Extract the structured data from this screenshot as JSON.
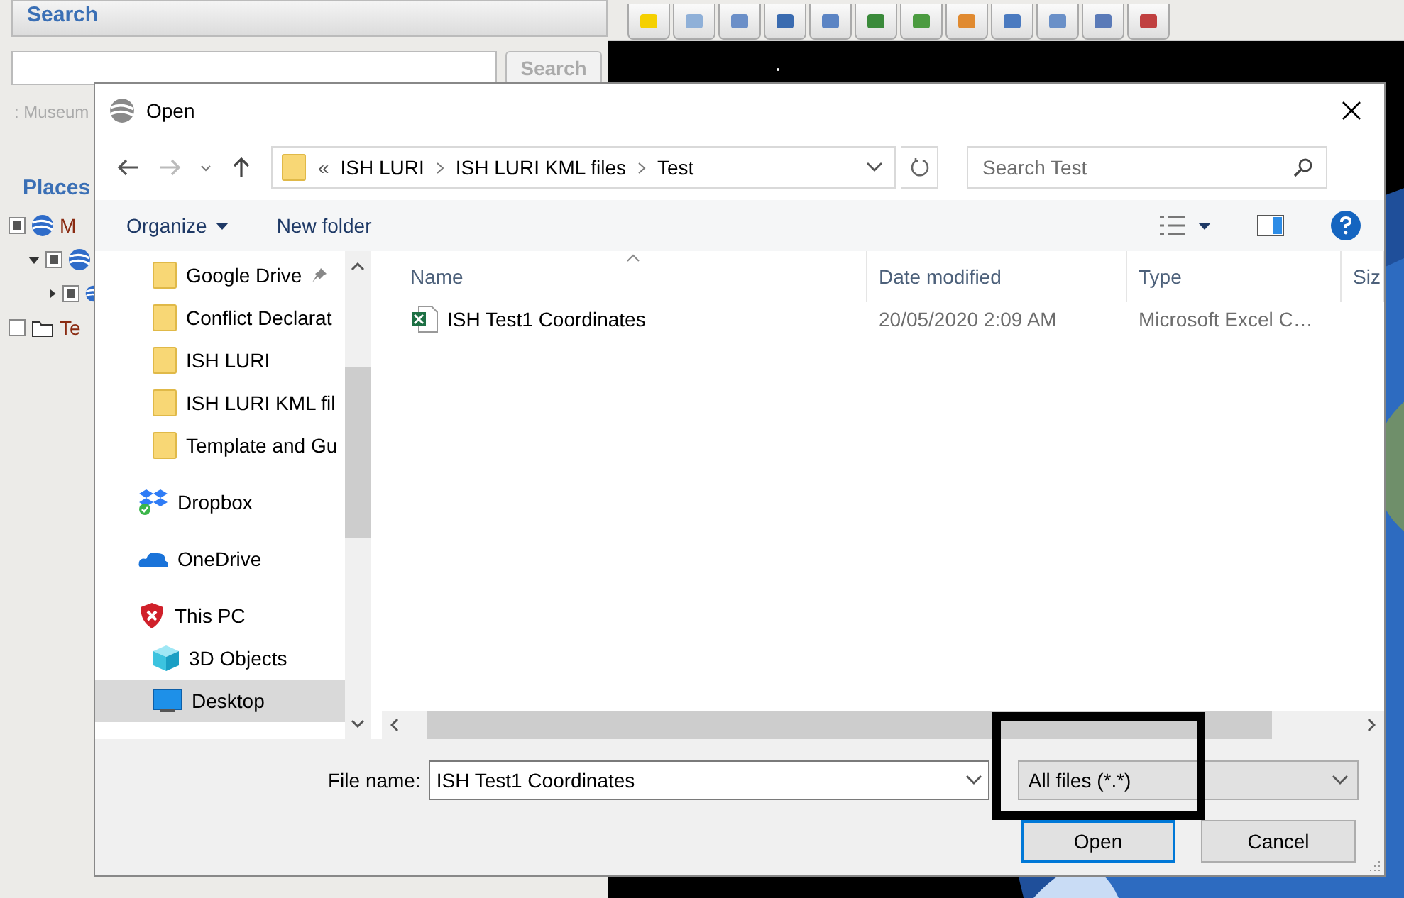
{
  "app": {
    "search_panel": {
      "title": "Search",
      "search_button": "Search",
      "query_hint": ": Museum"
    },
    "places": {
      "title": "Places",
      "items": [
        {
          "label": "M",
          "checked": true,
          "children": [
            {
              "checked": true,
              "expanded": true,
              "children": [
                {
                  "checked": true,
                  "expanded": false
                }
              ]
            }
          ]
        },
        {
          "label": "Te",
          "checked": false,
          "kind": "folder"
        }
      ]
    }
  },
  "dialog": {
    "title": "Open",
    "breadcrumb": {
      "overflow": "«",
      "parts": [
        "ISH LURI",
        "ISH LURI KML files",
        "Test"
      ]
    },
    "search": {
      "placeholder": "Search Test"
    },
    "commands": [
      {
        "label": "Organize",
        "dropdown": true
      },
      {
        "label": "New folder",
        "dropdown": false
      }
    ],
    "nav_pane": [
      {
        "kind": "folder",
        "label": "Google Drive",
        "pinned": true,
        "selected": false
      },
      {
        "kind": "folder",
        "label": "Conflict Declarat",
        "pinned": false,
        "selected": false
      },
      {
        "kind": "folder",
        "label": "ISH LURI",
        "pinned": false,
        "selected": false
      },
      {
        "kind": "folder",
        "label": "ISH LURI KML fil",
        "pinned": false,
        "selected": false
      },
      {
        "kind": "folder",
        "label": "Template and Gu",
        "pinned": false,
        "selected": false
      },
      {
        "kind": "dropbox",
        "label": "Dropbox",
        "selected": false
      },
      {
        "kind": "cloud",
        "label": "OneDrive",
        "selected": false
      },
      {
        "kind": "pc",
        "label": "This PC",
        "selected": false,
        "children": [
          {
            "kind": "cube",
            "label": "3D Objects",
            "selected": false
          },
          {
            "kind": "desktop",
            "label": "Desktop",
            "selected": true
          }
        ]
      }
    ],
    "columns": [
      "Name",
      "Date modified",
      "Type",
      "Siz"
    ],
    "files": [
      {
        "kind": "excel",
        "name": "ISH Test1 Coordinates",
        "date": "20/05/2020 2:09 AM",
        "type": "Microsoft Excel C…",
        "selected": false
      }
    ],
    "file_name": {
      "label": "File name:",
      "value": "ISH Test1 Coordinates"
    },
    "file_type": {
      "value": "All files (*.*)"
    },
    "buttons": [
      {
        "label": "Open",
        "default": true
      },
      {
        "label": "Cancel",
        "default": false
      }
    ]
  }
}
